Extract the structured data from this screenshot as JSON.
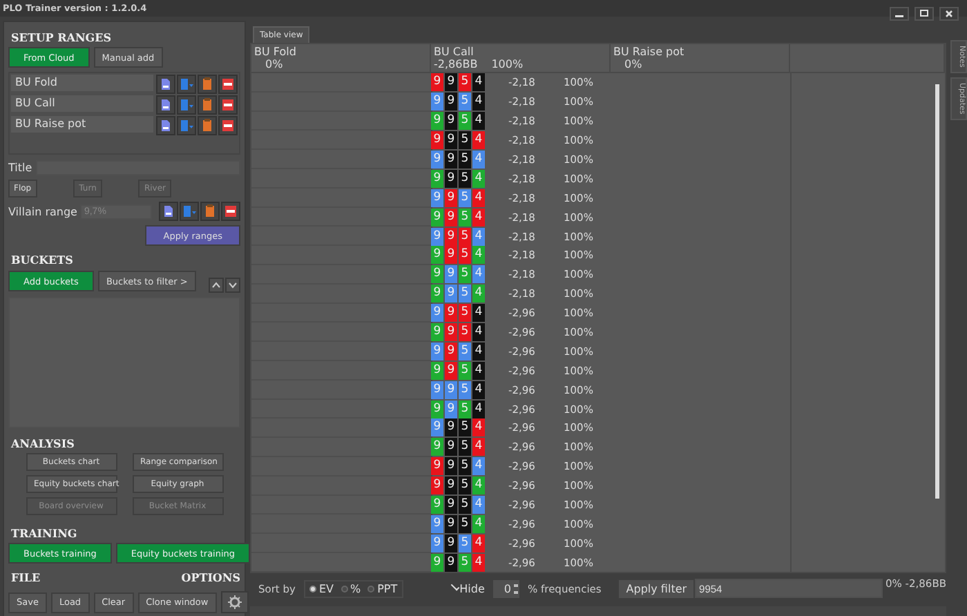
{
  "window": {
    "title": "PLO Trainer version : 1.2.0.4"
  },
  "side_tabs": [
    {
      "label": "Notes"
    },
    {
      "label": "Updates"
    }
  ],
  "setup": {
    "heading": "SETUP RANGES",
    "source_buttons": [
      {
        "label": "From Cloud",
        "kind": "primary"
      },
      {
        "label": "Manual add",
        "kind": "plain"
      }
    ],
    "ranges": [
      {
        "name": "BU Fold"
      },
      {
        "name": "BU Call"
      },
      {
        "name": "BU Raise pot"
      }
    ],
    "title_label": "Title",
    "streets": [
      {
        "label": "Flop",
        "disabled": false
      },
      {
        "label": "Turn",
        "disabled": true
      },
      {
        "label": "River",
        "disabled": true
      }
    ],
    "villain_label": "Villain range",
    "villain_placeholder": "9,7%",
    "apply_button": "Apply ranges"
  },
  "buckets": {
    "heading": "BUCKETS",
    "buttons": [
      {
        "label": "Add buckets",
        "kind": "primary"
      },
      {
        "label": "Buckets to filter >",
        "kind": "plain"
      }
    ]
  },
  "analysis": {
    "heading": "ANALYSIS",
    "buttons": [
      {
        "label": "Buckets chart",
        "disabled": false
      },
      {
        "label": "Range comparison",
        "disabled": false
      },
      {
        "label": "Equity buckets chart",
        "disabled": false
      },
      {
        "label": "Equity graph",
        "disabled": false
      },
      {
        "label": "Board overview",
        "disabled": true
      },
      {
        "label": "Bucket Matrix",
        "disabled": true
      }
    ]
  },
  "training": {
    "heading": "TRAINING",
    "buttons": [
      {
        "label": "Buckets training",
        "kind": "primary"
      },
      {
        "label": "Equity buckets training",
        "kind": "primary"
      }
    ]
  },
  "file": {
    "heading": "FILE",
    "options_heading": "OPTIONS",
    "buttons": [
      {
        "label": "Save"
      },
      {
        "label": "Load"
      },
      {
        "label": "Clear"
      },
      {
        "label": "Clone window"
      }
    ]
  },
  "view_tab": {
    "label": "Table view"
  },
  "table": {
    "columns": [
      {
        "name": "BU Fold",
        "pct": "0%"
      },
      {
        "name": "BU Call",
        "ev": "-2,86BB",
        "pct": "100%"
      },
      {
        "name": "BU Raise pot",
        "pct": "0%"
      }
    ],
    "rows": [
      {
        "cards": [
          {
            "rank": "9",
            "color": "#e8141c"
          },
          {
            "rank": "9",
            "color": "#111111"
          },
          {
            "rank": "5",
            "color": "#e8141c"
          },
          {
            "rank": "4",
            "color": "#111111"
          }
        ],
        "ev": "-2,18",
        "pct": "100%"
      },
      {
        "cards": [
          {
            "rank": "9",
            "color": "#4a8ae8"
          },
          {
            "rank": "9",
            "color": "#111111"
          },
          {
            "rank": "5",
            "color": "#4a8ae8"
          },
          {
            "rank": "4",
            "color": "#111111"
          }
        ],
        "ev": "-2,18",
        "pct": "100%"
      },
      {
        "cards": [
          {
            "rank": "9",
            "color": "#1fae33"
          },
          {
            "rank": "9",
            "color": "#111111"
          },
          {
            "rank": "5",
            "color": "#1fae33"
          },
          {
            "rank": "4",
            "color": "#111111"
          }
        ],
        "ev": "-2,18",
        "pct": "100%"
      },
      {
        "cards": [
          {
            "rank": "9",
            "color": "#e8141c"
          },
          {
            "rank": "9",
            "color": "#111111"
          },
          {
            "rank": "5",
            "color": "#111111"
          },
          {
            "rank": "4",
            "color": "#e8141c"
          }
        ],
        "ev": "-2,18",
        "pct": "100%"
      },
      {
        "cards": [
          {
            "rank": "9",
            "color": "#4a8ae8"
          },
          {
            "rank": "9",
            "color": "#111111"
          },
          {
            "rank": "5",
            "color": "#111111"
          },
          {
            "rank": "4",
            "color": "#4a8ae8"
          }
        ],
        "ev": "-2,18",
        "pct": "100%"
      },
      {
        "cards": [
          {
            "rank": "9",
            "color": "#1fae33"
          },
          {
            "rank": "9",
            "color": "#111111"
          },
          {
            "rank": "5",
            "color": "#111111"
          },
          {
            "rank": "4",
            "color": "#1fae33"
          }
        ],
        "ev": "-2,18",
        "pct": "100%"
      },
      {
        "cards": [
          {
            "rank": "9",
            "color": "#4a8ae8"
          },
          {
            "rank": "9",
            "color": "#e8141c"
          },
          {
            "rank": "5",
            "color": "#4a8ae8"
          },
          {
            "rank": "4",
            "color": "#e8141c"
          }
        ],
        "ev": "-2,18",
        "pct": "100%"
      },
      {
        "cards": [
          {
            "rank": "9",
            "color": "#1fae33"
          },
          {
            "rank": "9",
            "color": "#e8141c"
          },
          {
            "rank": "5",
            "color": "#1fae33"
          },
          {
            "rank": "4",
            "color": "#e8141c"
          }
        ],
        "ev": "-2,18",
        "pct": "100%"
      },
      {
        "cards": [
          {
            "rank": "9",
            "color": "#4a8ae8"
          },
          {
            "rank": "9",
            "color": "#e8141c"
          },
          {
            "rank": "5",
            "color": "#e8141c"
          },
          {
            "rank": "4",
            "color": "#4a8ae8"
          }
        ],
        "ev": "-2,18",
        "pct": "100%"
      },
      {
        "cards": [
          {
            "rank": "9",
            "color": "#1fae33"
          },
          {
            "rank": "9",
            "color": "#e8141c"
          },
          {
            "rank": "5",
            "color": "#e8141c"
          },
          {
            "rank": "4",
            "color": "#1fae33"
          }
        ],
        "ev": "-2,18",
        "pct": "100%"
      },
      {
        "cards": [
          {
            "rank": "9",
            "color": "#1fae33"
          },
          {
            "rank": "9",
            "color": "#4a8ae8"
          },
          {
            "rank": "5",
            "color": "#1fae33"
          },
          {
            "rank": "4",
            "color": "#4a8ae8"
          }
        ],
        "ev": "-2,18",
        "pct": "100%"
      },
      {
        "cards": [
          {
            "rank": "9",
            "color": "#1fae33"
          },
          {
            "rank": "9",
            "color": "#4a8ae8"
          },
          {
            "rank": "5",
            "color": "#4a8ae8"
          },
          {
            "rank": "4",
            "color": "#1fae33"
          }
        ],
        "ev": "-2,18",
        "pct": "100%"
      },
      {
        "cards": [
          {
            "rank": "9",
            "color": "#4a8ae8"
          },
          {
            "rank": "9",
            "color": "#e8141c"
          },
          {
            "rank": "5",
            "color": "#e8141c"
          },
          {
            "rank": "4",
            "color": "#111111"
          }
        ],
        "ev": "-2,96",
        "pct": "100%"
      },
      {
        "cards": [
          {
            "rank": "9",
            "color": "#1fae33"
          },
          {
            "rank": "9",
            "color": "#e8141c"
          },
          {
            "rank": "5",
            "color": "#e8141c"
          },
          {
            "rank": "4",
            "color": "#111111"
          }
        ],
        "ev": "-2,96",
        "pct": "100%"
      },
      {
        "cards": [
          {
            "rank": "9",
            "color": "#4a8ae8"
          },
          {
            "rank": "9",
            "color": "#e8141c"
          },
          {
            "rank": "5",
            "color": "#4a8ae8"
          },
          {
            "rank": "4",
            "color": "#111111"
          }
        ],
        "ev": "-2,96",
        "pct": "100%"
      },
      {
        "cards": [
          {
            "rank": "9",
            "color": "#1fae33"
          },
          {
            "rank": "9",
            "color": "#e8141c"
          },
          {
            "rank": "5",
            "color": "#1fae33"
          },
          {
            "rank": "4",
            "color": "#111111"
          }
        ],
        "ev": "-2,96",
        "pct": "100%"
      },
      {
        "cards": [
          {
            "rank": "9",
            "color": "#4a8ae8"
          },
          {
            "rank": "9",
            "color": "#4a8ae8"
          },
          {
            "rank": "5",
            "color": "#4a8ae8"
          },
          {
            "rank": "4",
            "color": "#111111"
          }
        ],
        "ev": "-2,96",
        "pct": "100%"
      },
      {
        "cards": [
          {
            "rank": "9",
            "color": "#1fae33"
          },
          {
            "rank": "9",
            "color": "#4a8ae8"
          },
          {
            "rank": "5",
            "color": "#1fae33"
          },
          {
            "rank": "4",
            "color": "#111111"
          }
        ],
        "ev": "-2,96",
        "pct": "100%"
      },
      {
        "cards": [
          {
            "rank": "9",
            "color": "#4a8ae8"
          },
          {
            "rank": "9",
            "color": "#111111"
          },
          {
            "rank": "5",
            "color": "#111111"
          },
          {
            "rank": "4",
            "color": "#e8141c"
          }
        ],
        "ev": "-2,96",
        "pct": "100%"
      },
      {
        "cards": [
          {
            "rank": "9",
            "color": "#1fae33"
          },
          {
            "rank": "9",
            "color": "#111111"
          },
          {
            "rank": "5",
            "color": "#111111"
          },
          {
            "rank": "4",
            "color": "#e8141c"
          }
        ],
        "ev": "-2,96",
        "pct": "100%"
      },
      {
        "cards": [
          {
            "rank": "9",
            "color": "#e8141c"
          },
          {
            "rank": "9",
            "color": "#111111"
          },
          {
            "rank": "5",
            "color": "#111111"
          },
          {
            "rank": "4",
            "color": "#4a8ae8"
          }
        ],
        "ev": "-2,96",
        "pct": "100%"
      },
      {
        "cards": [
          {
            "rank": "9",
            "color": "#e8141c"
          },
          {
            "rank": "9",
            "color": "#111111"
          },
          {
            "rank": "5",
            "color": "#111111"
          },
          {
            "rank": "4",
            "color": "#1fae33"
          }
        ],
        "ev": "-2,96",
        "pct": "100%"
      },
      {
        "cards": [
          {
            "rank": "9",
            "color": "#1fae33"
          },
          {
            "rank": "9",
            "color": "#111111"
          },
          {
            "rank": "5",
            "color": "#111111"
          },
          {
            "rank": "4",
            "color": "#4a8ae8"
          }
        ],
        "ev": "-2,96",
        "pct": "100%"
      },
      {
        "cards": [
          {
            "rank": "9",
            "color": "#4a8ae8"
          },
          {
            "rank": "9",
            "color": "#111111"
          },
          {
            "rank": "5",
            "color": "#111111"
          },
          {
            "rank": "4",
            "color": "#1fae33"
          }
        ],
        "ev": "-2,96",
        "pct": "100%"
      },
      {
        "cards": [
          {
            "rank": "9",
            "color": "#4a8ae8"
          },
          {
            "rank": "9",
            "color": "#111111"
          },
          {
            "rank": "5",
            "color": "#4a8ae8"
          },
          {
            "rank": "4",
            "color": "#e8141c"
          }
        ],
        "ev": "-2,96",
        "pct": "100%"
      },
      {
        "cards": [
          {
            "rank": "9",
            "color": "#1fae33"
          },
          {
            "rank": "9",
            "color": "#111111"
          },
          {
            "rank": "5",
            "color": "#1fae33"
          },
          {
            "rank": "4",
            "color": "#e8141c"
          }
        ],
        "ev": "-2,96",
        "pct": "100%"
      }
    ]
  },
  "bottom_bar": {
    "sort_label": "Sort by",
    "sort_options": [
      {
        "label": "EV",
        "selected": true
      },
      {
        "label": "%",
        "selected": false
      },
      {
        "label": "PPT",
        "selected": false
      }
    ],
    "hide": {
      "label": "Hide",
      "checked": true
    },
    "spinner_value": "0",
    "frequencies_label": "% frequencies",
    "apply_filter": "Apply filter",
    "filter_value": "9954",
    "summary": "0% -2,86BB"
  }
}
